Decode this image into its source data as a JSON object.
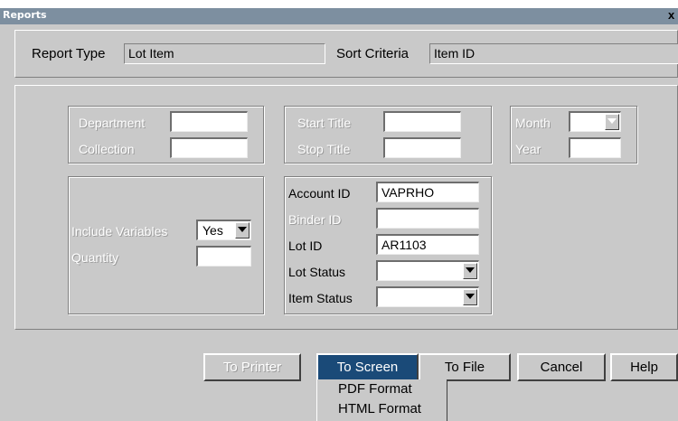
{
  "window": {
    "title": "Reports",
    "close_glyph": "x"
  },
  "report": {
    "type_label": "Report Type",
    "type_value": "Lot Item",
    "sort_label": "Sort Criteria",
    "sort_value": "Item ID"
  },
  "filters": {
    "department_label": "Department",
    "collection_label": "Collection",
    "start_title_label": "Start Title",
    "stop_title_label": "Stop Title",
    "month_label": "Month",
    "year_label": "Year",
    "include_variables_label": "Include Variables",
    "include_variables_value": "Yes",
    "quantity_label": "Quantity",
    "account_id_label": "Account ID",
    "account_id_value": "VAPRHO",
    "binder_id_label": "Binder ID",
    "lot_id_label": "Lot ID",
    "lot_id_value": "AR1103",
    "lot_status_label": "Lot Status",
    "item_status_label": "Item Status"
  },
  "buttons": {
    "to_printer": "To Printer",
    "to_screen": "To Screen",
    "to_file": "To File",
    "cancel": "Cancel",
    "help": "Help"
  },
  "screen_menu": {
    "items": [
      "PDF Format",
      "HTML Format"
    ]
  },
  "icons": {
    "dropdown": "chevron-down-icon",
    "close": "close-icon"
  }
}
